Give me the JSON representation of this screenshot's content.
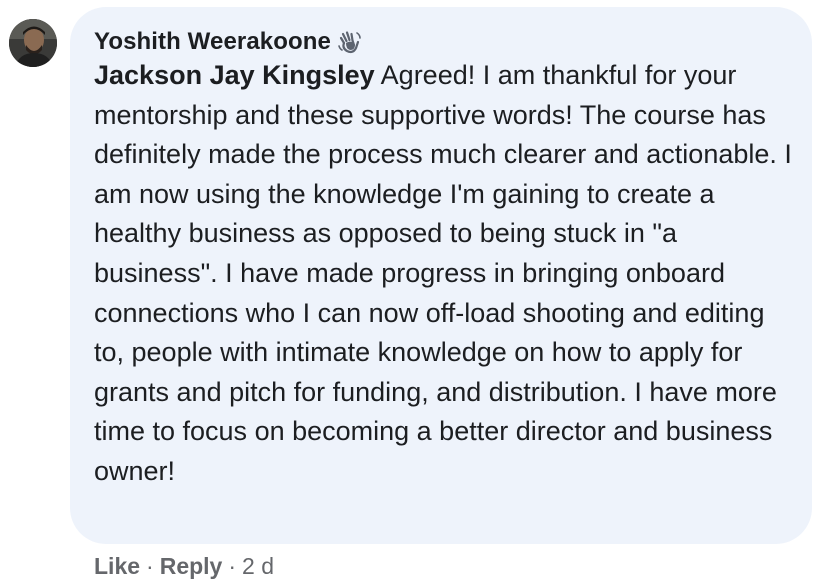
{
  "comment": {
    "author": "Yoshith Weerakoone",
    "badge_icon": "waving-hand-icon",
    "mention": "Jackson Jay Kingsley",
    "text": " Agreed! I am thankful for your mentorship and these supportive words! The course has definitely made the process much clearer and actionable. I am now using the knowledge I'm gaining to create a healthy business as opposed to being stuck in \"a business\". I have made progress in bringing onboard connections who I can now off-load shooting and editing to, people with intimate knowledge on how to apply for grants and pitch for funding, and distribution. I have more time to focus on becoming a better director and business owner!",
    "bubble_color": "#eef3fb"
  },
  "actions": {
    "like_label": "Like",
    "separator": "·",
    "reply_label": "Reply",
    "timestamp": "2 d"
  }
}
